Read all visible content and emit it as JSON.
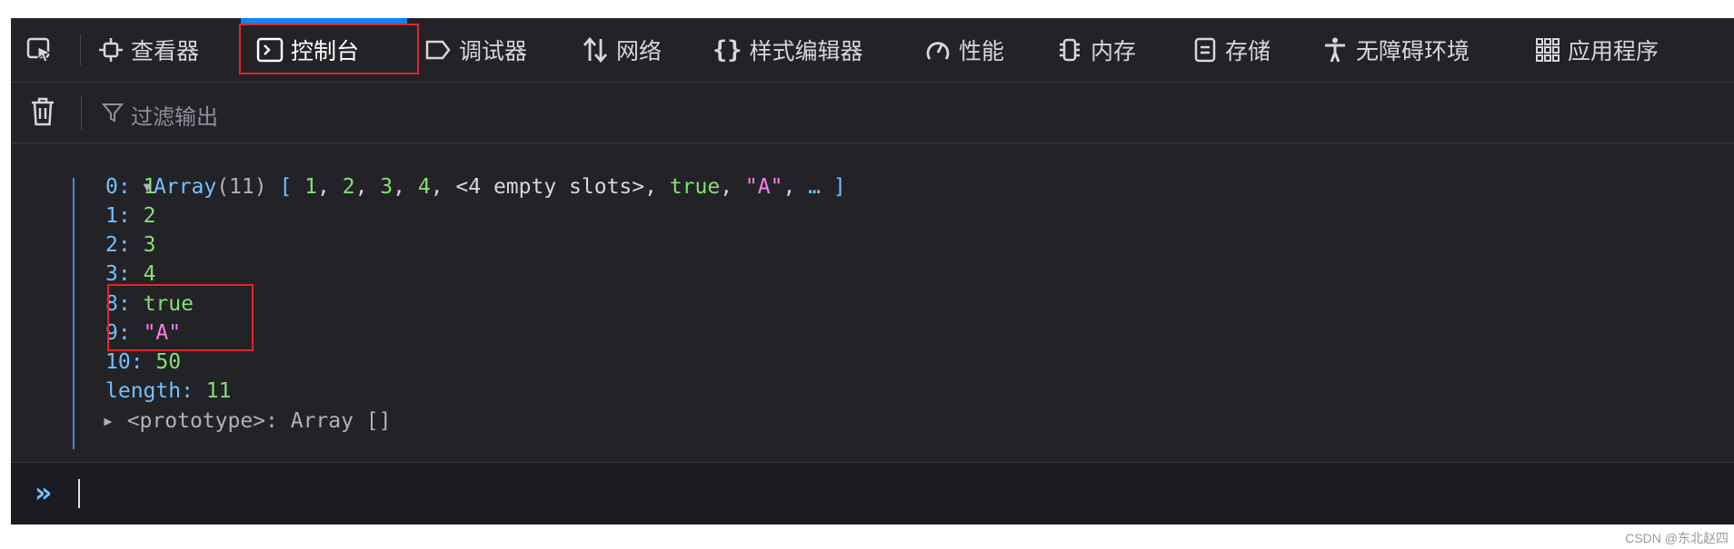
{
  "tabs": [
    {
      "label": "查看器",
      "icon": "inspector-icon"
    },
    {
      "label": "控制台",
      "icon": "console-icon",
      "selected": true
    },
    {
      "label": "调试器",
      "icon": "debugger-icon"
    },
    {
      "label": "网络",
      "icon": "network-icon"
    },
    {
      "label": "样式编辑器",
      "icon": "style-editor-icon"
    },
    {
      "label": "性能",
      "icon": "performance-icon"
    },
    {
      "label": "内存",
      "icon": "memory-icon"
    },
    {
      "label": "存储",
      "icon": "storage-icon"
    },
    {
      "label": "无障碍环境",
      "icon": "accessibility-icon"
    },
    {
      "label": "应用程序",
      "icon": "application-icon"
    }
  ],
  "toolbar": {
    "filter_placeholder": "过滤输出"
  },
  "console": {
    "array_summary": {
      "name": "Array",
      "count": "(11)",
      "preview_open": "[ ",
      "items": [
        "1",
        "2",
        "3",
        "4"
      ],
      "empty_slots": "<4 empty slots>",
      "bool_item": "true",
      "str_item": "\"A\"",
      "ellipsis": "…",
      "preview_close": " ]"
    },
    "entries": [
      {
        "key": "0",
        "value": "1",
        "type": "num"
      },
      {
        "key": "1",
        "value": "2",
        "type": "num"
      },
      {
        "key": "2",
        "value": "3",
        "type": "num"
      },
      {
        "key": "3",
        "value": "4",
        "type": "num"
      },
      {
        "key": "8",
        "value": "true",
        "type": "num"
      },
      {
        "key": "9",
        "value": "\"A\"",
        "type": "str"
      },
      {
        "key": "10",
        "value": "50",
        "type": "num"
      },
      {
        "key": "length",
        "value": "11",
        "type": "num"
      }
    ],
    "prototype": "<prototype>: Array []"
  },
  "input": {
    "prompt": "»"
  },
  "watermark": "CSDN @东北赵四",
  "colors": {
    "accent": "#0a84ff",
    "highlight": "#e0262c",
    "key": "#75bfff",
    "number": "#86de74",
    "string": "#ff7de9"
  }
}
